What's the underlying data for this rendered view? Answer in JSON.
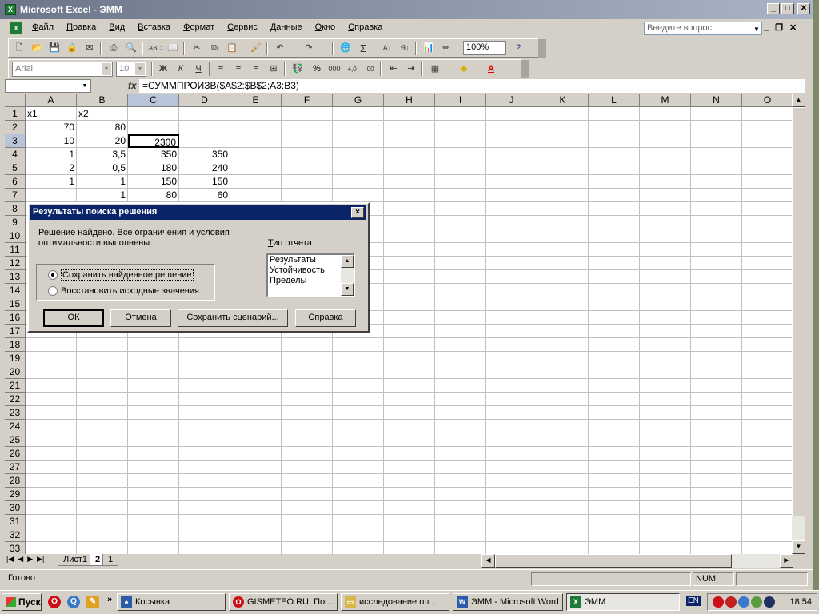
{
  "window": {
    "title": "Microsoft Excel - ЭММ",
    "app_icon_glyph": "X"
  },
  "menu": {
    "items": [
      "Файл",
      "Правка",
      "Вид",
      "Вставка",
      "Формат",
      "Сервис",
      "Данные",
      "Окно",
      "Справка"
    ],
    "help_placeholder": "Введите вопрос"
  },
  "toolbar": {
    "zoom": "100%",
    "font_name": "Arial",
    "font_size": "10",
    "bold_glyph": "Ж",
    "italic_glyph": "К",
    "underline_glyph": "Ч",
    "percent_glyph": "%",
    "thousands_glyph": "000"
  },
  "formula_bar": {
    "name_box": "",
    "fx": "fx",
    "formula": "=СУММПРОИЗВ($A$2:$B$2;A3:B3)"
  },
  "sheet": {
    "columns": [
      "A",
      "B",
      "C",
      "D",
      "E",
      "F",
      "G",
      "H",
      "I",
      "J",
      "K",
      "L",
      "M",
      "N",
      "O"
    ],
    "selected_column": "C",
    "selected_row": 3,
    "rows": [
      {
        "n": "1",
        "cells": [
          "x1",
          "x2",
          "",
          ""
        ]
      },
      {
        "n": "2",
        "cells": [
          "70",
          "80",
          "",
          ""
        ]
      },
      {
        "n": "3",
        "cells": [
          "10",
          "20",
          "2300",
          ""
        ]
      },
      {
        "n": "4",
        "cells": [
          "1",
          "3,5",
          "350",
          "350"
        ]
      },
      {
        "n": "5",
        "cells": [
          "2",
          "0,5",
          "180",
          "240"
        ]
      },
      {
        "n": "6",
        "cells": [
          "1",
          "1",
          "150",
          "150"
        ]
      },
      {
        "n": "7",
        "cells": [
          "",
          "1",
          "80",
          "60"
        ]
      },
      {
        "n": "8",
        "cells": []
      },
      {
        "n": "9",
        "cells": []
      },
      {
        "n": "10",
        "cells": []
      },
      {
        "n": "11",
        "cells": []
      },
      {
        "n": "12",
        "cells": []
      },
      {
        "n": "13",
        "cells": []
      },
      {
        "n": "14",
        "cells": []
      },
      {
        "n": "15",
        "cells": []
      },
      {
        "n": "16",
        "cells": []
      },
      {
        "n": "17",
        "cells": []
      },
      {
        "n": "18",
        "cells": []
      },
      {
        "n": "19",
        "cells": []
      },
      {
        "n": "20",
        "cells": []
      },
      {
        "n": "21",
        "cells": []
      },
      {
        "n": "22",
        "cells": []
      },
      {
        "n": "23",
        "cells": []
      },
      {
        "n": "24",
        "cells": []
      },
      {
        "n": "25",
        "cells": []
      },
      {
        "n": "26",
        "cells": []
      },
      {
        "n": "27",
        "cells": []
      },
      {
        "n": "28",
        "cells": []
      },
      {
        "n": "29",
        "cells": []
      },
      {
        "n": "30",
        "cells": []
      },
      {
        "n": "31",
        "cells": []
      },
      {
        "n": "32",
        "cells": []
      },
      {
        "n": "33",
        "cells": []
      }
    ],
    "tabs": [
      "Лист1",
      "2",
      "1"
    ],
    "active_tab": "2"
  },
  "status": {
    "ready": "Готово",
    "num": "NUM"
  },
  "dialog": {
    "title": "Результаты поиска решения",
    "close": "×",
    "message": "Решение найдено. Все ограничения и условия оптимальности выполнены.",
    "report_label": "Тип отчета",
    "report_types": [
      "Результаты",
      "Устойчивость",
      "Пределы"
    ],
    "option_keep": "Сохранить найденное решение",
    "option_restore": "Восстановить исходные значения",
    "btn_ok": "ОК",
    "btn_cancel": "Отмена",
    "btn_save_scenario": "Сохранить сценарий...",
    "btn_help": "Справка"
  },
  "taskbar": {
    "start": "Пуск",
    "more": "»",
    "tasks": [
      {
        "label": "Косынка",
        "icon": "cards-icon",
        "color": "#2a5caa"
      },
      {
        "label": "GISMETEO.RU: Пог...",
        "icon": "opera-icon",
        "color": "#cc0f16"
      },
      {
        "label": "исследование оп...",
        "icon": "folder-icon",
        "color": "#d9b64a"
      },
      {
        "label": "ЭММ - Microsoft Word",
        "icon": "word-icon",
        "color": "#2a5caa"
      },
      {
        "label": "ЭММ",
        "icon": "excel-icon",
        "color": "#1e7b35"
      }
    ],
    "lang": "EN",
    "clock": "18:54"
  }
}
